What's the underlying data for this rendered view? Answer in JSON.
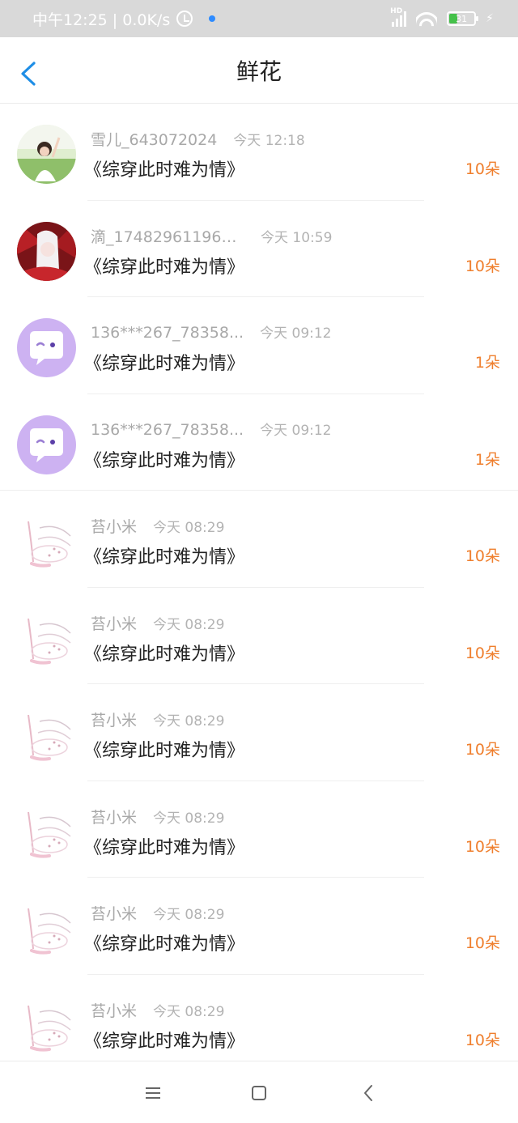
{
  "status_bar": {
    "time_speed": "中午12:25 | 0.0K/s",
    "battery_level": "31",
    "battery_color": "#45c14a"
  },
  "header": {
    "title": "鲜花",
    "accent_color": "#1e8ee6"
  },
  "qty_color": "#ef7f2e",
  "rows": [
    {
      "name": "雪儿_643072024",
      "time": "今天 12:18",
      "book": "《综穿此时难为情》",
      "qty": "10朵",
      "avatar": "photo-girl-avatar"
    },
    {
      "name": "滴_174829611961...",
      "time": "今天 10:59",
      "book": "《综穿此时难为情》",
      "qty": "10朵",
      "avatar": "anime-red-avatar"
    },
    {
      "name": "136***267_78358...",
      "time": "今天 09:12",
      "book": "《综穿此时难为情》",
      "qty": "1朵",
      "avatar": "default-chat-avatar"
    },
    {
      "name": "136***267_78358...",
      "time": "今天 09:12",
      "book": "《综穿此时难为情》",
      "qty": "1朵",
      "avatar": "default-chat-avatar"
    },
    {
      "name": "苔小米",
      "time": "今天 08:29",
      "book": "《综穿此时难为情》",
      "qty": "10朵",
      "avatar": "sketch-bunny-avatar"
    },
    {
      "name": "苔小米",
      "time": "今天 08:29",
      "book": "《综穿此时难为情》",
      "qty": "10朵",
      "avatar": "sketch-bunny-avatar"
    },
    {
      "name": "苔小米",
      "time": "今天 08:29",
      "book": "《综穿此时难为情》",
      "qty": "10朵",
      "avatar": "sketch-bunny-avatar"
    },
    {
      "name": "苔小米",
      "time": "今天 08:29",
      "book": "《综穿此时难为情》",
      "qty": "10朵",
      "avatar": "sketch-bunny-avatar"
    },
    {
      "name": "苔小米",
      "time": "今天 08:29",
      "book": "《综穿此时难为情》",
      "qty": "10朵",
      "avatar": "sketch-bunny-avatar"
    },
    {
      "name": "苔小米",
      "time": "今天 08:29",
      "book": "《综穿此时难为情》",
      "qty": "10朵",
      "avatar": "sketch-bunny-avatar"
    }
  ],
  "nav": {
    "menu_icon": "menu-icon",
    "home_icon": "home-square-icon",
    "back_icon": "back-chevron-icon"
  }
}
